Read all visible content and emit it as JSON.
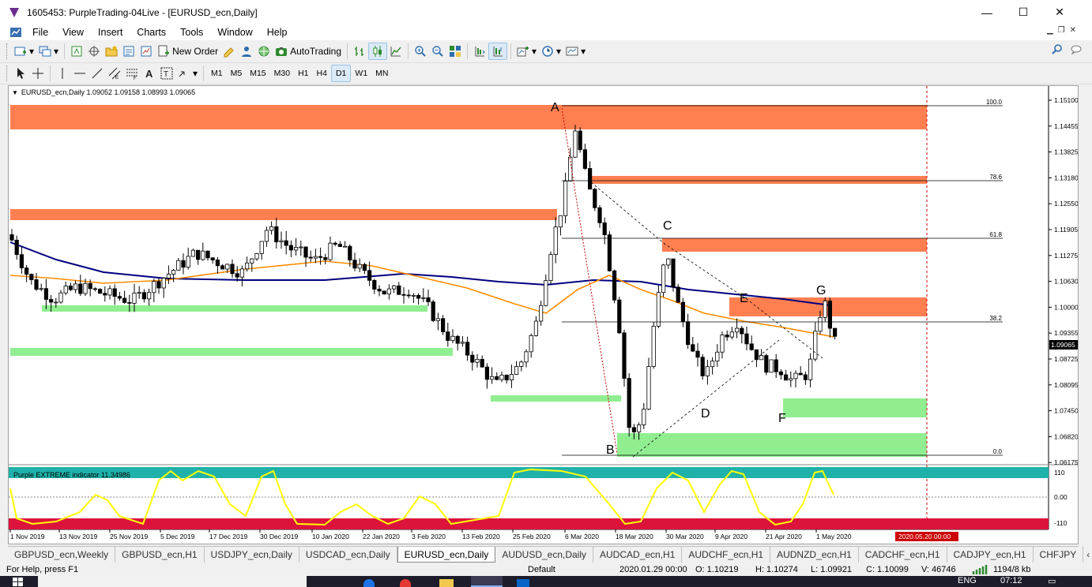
{
  "window": {
    "title": "1605453: PurpleTrading-04Live - [EURUSD_ecn,Daily]",
    "minimize": "—",
    "maximize": "☐",
    "close": "✕"
  },
  "menu": [
    "File",
    "View",
    "Insert",
    "Charts",
    "Tools",
    "Window",
    "Help"
  ],
  "toolbar": {
    "new_order": "New Order",
    "autotrading": "AutoTrading"
  },
  "timeframes": [
    "M1",
    "M5",
    "M15",
    "M30",
    "H1",
    "H4",
    "D1",
    "W1",
    "MN"
  ],
  "chart": {
    "header": "EURUSD_ecn,Daily  1.09052 1.09158 1.08993 1.09065",
    "current_price": "1.09065",
    "indicator_label": "Purple EXTREME indicator 11.34986",
    "price_ticks": [
      "1.15100",
      "1.14455",
      "1.13825",
      "1.13180",
      "1.12550",
      "1.11905",
      "1.11275",
      "1.10630",
      "1.10000",
      "1.09355",
      "1.08725",
      "1.08095",
      "1.07450",
      "1.06820",
      "1.06175"
    ],
    "indicator_ticks": [
      "110",
      "0.00",
      "-110"
    ],
    "date_ticks": [
      "1 Nov 2019",
      "13 Nov 2019",
      "25 Nov 2019",
      "5 Dec 2019",
      "17 Dec 2019",
      "30 Dec 2019",
      "10 Jan 2020",
      "22 Jan 2020",
      "3 Feb 2020",
      "13 Feb 2020",
      "25 Feb 2020",
      "6 Mar 2020",
      "18 Mar 2020",
      "30 Mar 2020",
      "9 Apr 2020",
      "21 Apr 2020",
      "1 May 2020"
    ],
    "future_date": "2020.05.20 00:00",
    "fib_levels": [
      "100.0",
      "78.6",
      "61.8",
      "38.2",
      "0.0"
    ],
    "wave_labels": [
      "A",
      "B",
      "C",
      "D",
      "E",
      "F",
      "G"
    ],
    "colors": {
      "supply_zone": "#ff7f50",
      "demand_zone": "#90ee90",
      "ma_slow": "#000080",
      "ma_fast": "#ff8c00",
      "indicator_line": "#ffff00",
      "indicator_top": "#20b2aa",
      "indicator_bottom": "#dc143c"
    }
  },
  "tabs": [
    "GBPUSD_ecn,Weekly",
    "GBPUSD_ecn,H1",
    "USDJPY_ecn,Daily",
    "USDCAD_ecn,Daily",
    "EURUSD_ecn,Daily",
    "AUDUSD_ecn,Daily",
    "AUDCAD_ecn,H1",
    "AUDCHF_ecn,H1",
    "AUDNZD_ecn,H1",
    "CADCHF_ecn,H1",
    "CADJPY_ecn,H1",
    "CHFJPY"
  ],
  "active_tab": "EURUSD_ecn,Daily",
  "status": {
    "help": "For Help, press F1",
    "profile": "Default",
    "datetime": "2020.01.29 00:00",
    "open": "O: 1.10219",
    "high": "H: 1.10274",
    "low": "L: 1.09921",
    "close": "C: 1.10099",
    "volume": "V: 46746",
    "traffic": "1194/8 kb"
  },
  "taskbar": {
    "language": "ENG",
    "time": "07:12"
  }
}
